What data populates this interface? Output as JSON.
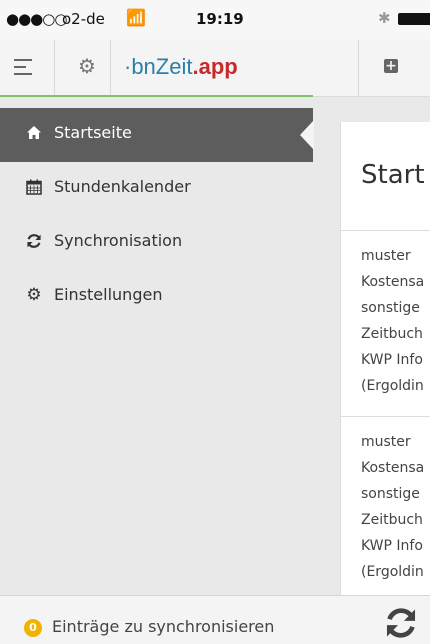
{
  "statusbar": {
    "signal": "●●●○○",
    "carrier": "o2-de",
    "time": "19:19"
  },
  "header": {
    "brand_prefix": "·bn",
    "brand_word": "Zeit",
    "brand_suffix": ".app",
    "icons": [
      "hamburger-icon",
      "gear-icon",
      "plus-square-icon"
    ]
  },
  "sidebar": {
    "items": [
      {
        "label": "Startseite",
        "icon": "home-icon",
        "active": true
      },
      {
        "label": "Stundenkalender",
        "icon": "calendar-icon",
        "active": false
      },
      {
        "label": "Synchronisation",
        "icon": "sync-icon",
        "active": false
      },
      {
        "label": "Einstellungen",
        "icon": "gear-icon",
        "active": false
      }
    ]
  },
  "content": {
    "title": "Start",
    "entries": [
      {
        "lines": [
          "muster",
          "Kostensa",
          "sonstige ",
          "Zeitbuch",
          "KWP Info",
          "(Ergoldin"
        ]
      },
      {
        "lines": [
          "muster",
          "Kostensa",
          "sonstige ",
          "Zeitbuch",
          "KWP Info",
          "(Ergoldin"
        ]
      }
    ]
  },
  "footer": {
    "count": "0",
    "text": "Einträge zu synchronisieren"
  },
  "colors": {
    "active_nav": "#5d5d5d",
    "accent_green": "#7fc36a",
    "brand_blue": "#2d7fa8",
    "brand_red": "#c52b2b",
    "badge": "#f0b400"
  }
}
